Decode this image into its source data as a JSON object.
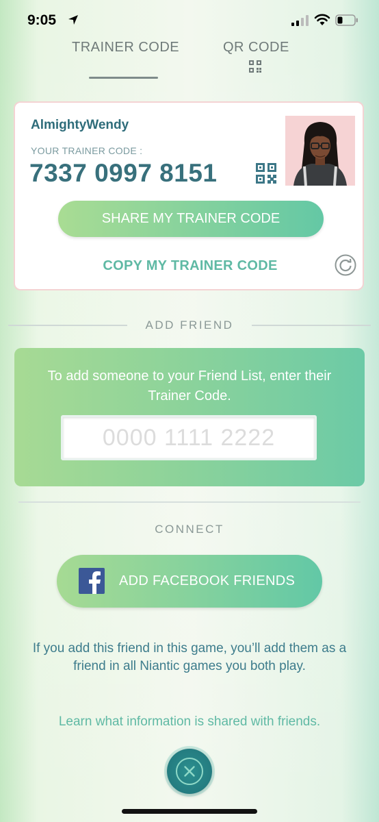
{
  "status_bar": {
    "time": "9:05"
  },
  "tabs": [
    {
      "label": "TRAINER CODE",
      "active": true
    },
    {
      "label": "QR CODE",
      "active": false
    }
  ],
  "profile": {
    "username": "AlmightyWendy",
    "code_label": "YOUR TRAINER CODE :",
    "trainer_code": "7337 0997 8151",
    "share_label": "SHARE MY TRAINER CODE",
    "copy_label": "COPY MY TRAINER CODE"
  },
  "add_friend": {
    "title": "ADD FRIEND",
    "instructions": "To add someone to your Friend List, enter their Trainer Code.",
    "input_placeholder": "0000 1111 2222",
    "input_value": ""
  },
  "connect": {
    "title": "CONNECT",
    "facebook_label": "ADD FACEBOOK FRIENDS",
    "note": "If you add this friend in this game, you’ll add them as a friend in all Niantic games you both play.",
    "learn_link": "Learn what information is shared with friends."
  },
  "icons": {
    "location": "location-arrow-icon",
    "signal": "cellular-signal-icon",
    "wifi": "wifi-icon",
    "battery": "battery-icon",
    "qr": "qr-code-icon",
    "refresh": "refresh-icon",
    "facebook": "facebook-icon",
    "close": "close-icon"
  },
  "colors": {
    "primary_text": "#2e6c7a",
    "accent_green": "#86d29d",
    "link_teal": "#5fb9a4",
    "close_button": "#247c80",
    "facebook_blue": "#3b5897"
  }
}
